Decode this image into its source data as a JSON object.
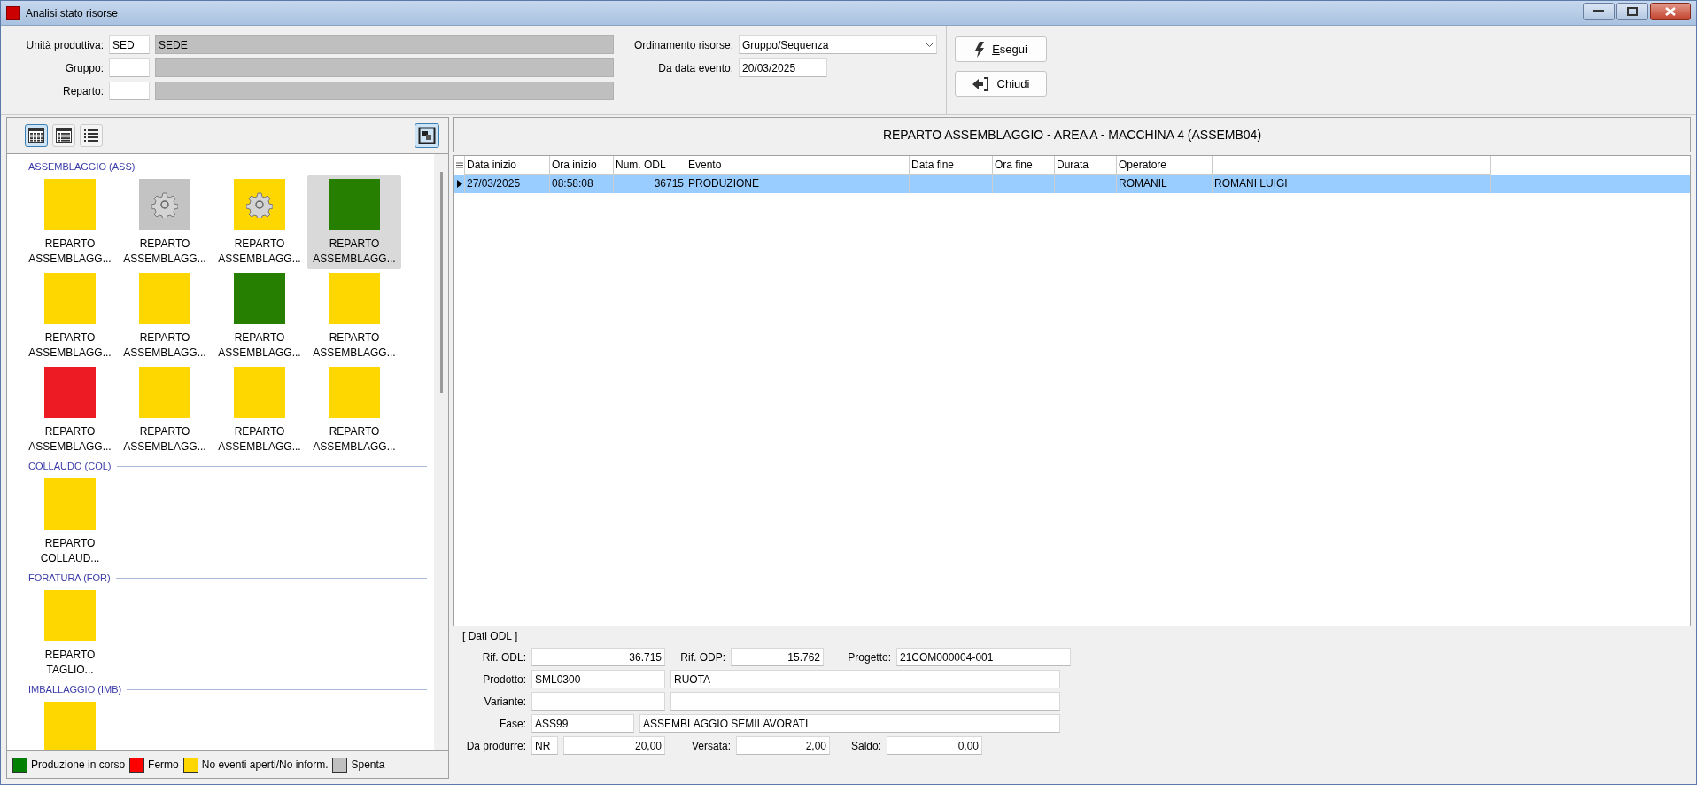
{
  "window": {
    "title": "Analisi stato risorse"
  },
  "filters": {
    "fields": [
      {
        "label": "Unità produttiva:",
        "code": "SED",
        "description": "SEDE"
      },
      {
        "label": "Gruppo:"
      },
      {
        "label": "Reparto:"
      }
    ],
    "sort": {
      "label": "Ordinamento risorse:",
      "value": "Gruppo/Sequenza"
    },
    "date": {
      "label": "Da data evento:",
      "value": "20/03/2025"
    }
  },
  "buttons": [
    {
      "label": "Esegui",
      "kind": "run"
    },
    {
      "label": "Chiudi",
      "kind": "close"
    }
  ],
  "view_modes": [
    {
      "kind": "grid",
      "selected": true
    },
    {
      "kind": "detail",
      "selected": false
    },
    {
      "kind": "list",
      "selected": false
    }
  ],
  "groups": [
    {
      "title": "ASSEMBLAGGIO (ASS)",
      "tiles": [
        {
          "label": "REPARTO ASSEMBLAGG...",
          "color": "#ffd700",
          "gear": false,
          "selected": false
        },
        {
          "label": "REPARTO ASSEMBLAGG...",
          "color": "#c3c3c3",
          "gear": true,
          "selected": false
        },
        {
          "label": "REPARTO ASSEMBLAGG...",
          "color": "#ffd700",
          "gear": true,
          "selected": false
        },
        {
          "label": "REPARTO ASSEMBLAGG...",
          "color": "#267f00",
          "gear": false,
          "selected": true
        },
        {
          "label": "REPARTO ASSEMBLAGG...",
          "color": "#ffd700",
          "gear": false,
          "selected": false
        },
        {
          "label": "REPARTO ASSEMBLAGG...",
          "color": "#ffd700",
          "gear": false,
          "selected": false
        },
        {
          "label": "REPARTO ASSEMBLAGG...",
          "color": "#267f00",
          "gear": false,
          "selected": false
        },
        {
          "label": "REPARTO ASSEMBLAGG...",
          "color": "#ffd700",
          "gear": false,
          "selected": false
        },
        {
          "label": "REPARTO ASSEMBLAGG...",
          "color": "#ed1c24",
          "gear": false,
          "selected": false
        },
        {
          "label": "REPARTO ASSEMBLAGG...",
          "color": "#ffd700",
          "gear": false,
          "selected": false
        },
        {
          "label": "REPARTO ASSEMBLAGG...",
          "color": "#ffd700",
          "gear": false,
          "selected": false
        },
        {
          "label": "REPARTO ASSEMBLAGG...",
          "color": "#ffd700",
          "gear": false,
          "selected": false
        }
      ]
    },
    {
      "title": "COLLAUDO (COL)",
      "tiles": [
        {
          "label": "REPARTO COLLAUD...",
          "color": "#ffd700",
          "gear": false,
          "selected": false
        }
      ]
    },
    {
      "title": "FORATURA (FOR)",
      "tiles": [
        {
          "label": "REPARTO TAGLIO...",
          "color": "#ffd700",
          "gear": false,
          "selected": false
        }
      ]
    },
    {
      "title": "IMBALLAGGIO (IMB)",
      "tiles": [
        {
          "color": "#ffd700",
          "gear": false,
          "selected": false
        }
      ]
    }
  ],
  "legend": [
    {
      "label": "Produzione in corso",
      "color": "#008000"
    },
    {
      "label": "Fermo",
      "color": "#ff0000"
    },
    {
      "label": "No eventi aperti/No inform.",
      "color": "#ffd700"
    },
    {
      "label": "Spenta",
      "color": "#c0c0c0"
    }
  ],
  "resource_title": "REPARTO ASSEMBLAGGIO - AREA A - MACCHINA 4 (ASSEMB04)",
  "table": {
    "columns": [
      {
        "label": "Data inizio"
      },
      {
        "label": "Ora inizio"
      },
      {
        "label": "Num. ODL"
      },
      {
        "label": "Evento"
      },
      {
        "label": "Data fine"
      },
      {
        "label": "Ora fine"
      },
      {
        "label": "Durata"
      },
      {
        "label": "Operatore"
      },
      {}
    ],
    "rows": [
      {
        "selected": true,
        "cells": [
          "27/03/2025",
          "08:58:08",
          "36715",
          "PRODUZIONE",
          "",
          "",
          "",
          "ROMANIL",
          "ROMANI LUIGI"
        ]
      }
    ]
  },
  "order_data": {
    "title": "[ Dati ODL ]",
    "rif_odl": {
      "label": "Rif. ODL:",
      "value": "36.715"
    },
    "rif_odp": {
      "label": "Rif. ODP:",
      "value": "15.762"
    },
    "progetto": {
      "label": "Progetto:",
      "value": "21COM000004-001"
    },
    "prodotto": {
      "label": "Prodotto:",
      "code": "SML0300",
      "description": "RUOTA"
    },
    "variante": {
      "label": "Variante:"
    },
    "fase": {
      "label": "Fase:",
      "code": "ASS99",
      "description": "ASSEMBLAGGIO SEMILAVORATI"
    },
    "da_produrre": {
      "label": "Da produrre:",
      "unit": "NR",
      "value": "20,00"
    },
    "versata": {
      "label": "Versata:",
      "value": "2,00"
    },
    "saldo": {
      "label": "Saldo:",
      "value": "0,00"
    }
  }
}
